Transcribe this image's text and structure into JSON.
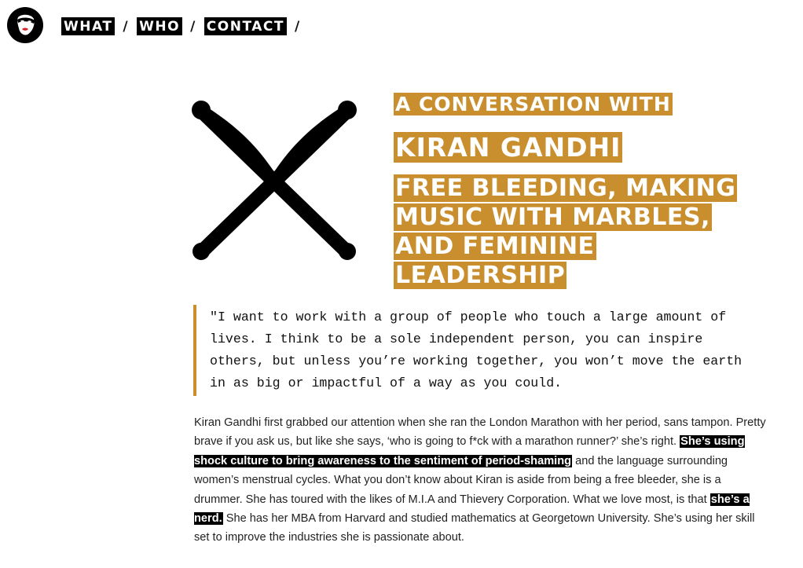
{
  "header": {
    "logo_icon": "masked-woman-face-icon",
    "nav": [
      {
        "label": "WHAT"
      },
      {
        "label": "WHO"
      },
      {
        "label": "CONTACT"
      }
    ],
    "separator": "/"
  },
  "hero": {
    "graphic_icon": "crossed-drumsticks-icon",
    "kicker": "A CONVERSATION WITH",
    "guest_name": "KIRAN GANDHI",
    "subtitle": "FREE BLEEDING, MAKING MUSIC WITH MARBLES, AND FEMININE LEADERSHIP",
    "accent_color": "#c98f2e"
  },
  "quote": {
    "text": "\"I want to work with a group of people who touch a large amount of lives. I think to be a sole independent person, you can inspire others, but unless you’re working together, you won’t move the earth in as big or impactful of a way as you could."
  },
  "article": {
    "p1_a": "Kiran Gandhi first grabbed our attention when she ran the London Marathon with her period, sans tampon. Pretty brave if you ask us, but like she says, ‘who is going to f*ck with a marathon runner?’ she’s right. ",
    "p1_highlight1": "She’s using shock culture to bring awareness to the sentiment of period-shaming",
    "p1_b": " and the language surrounding women’s menstrual cycles. What you don’t know about Kiran is aside from being a free bleeder, she is a drummer. She has toured with the likes of M.I.A and Thievery Corporation. What we love most, is that ",
    "p1_highlight2": "she’s a nerd.",
    "p1_c": " She has her MBA from Harvard and studied mathematics at Georgetown University. She’s using her skill set to improve the industries she is passionate about."
  }
}
